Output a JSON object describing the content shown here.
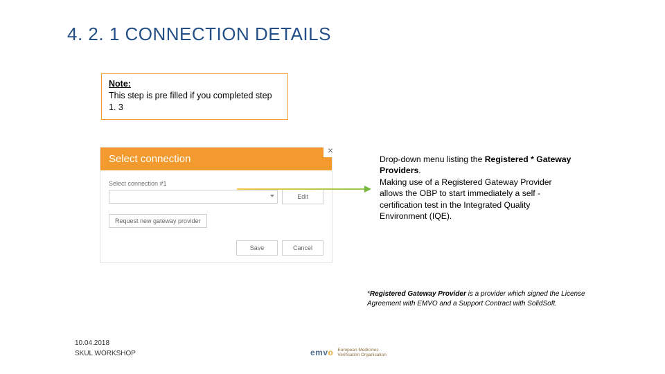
{
  "heading": "4. 2. 1 CONNECTION DETAILS",
  "note": {
    "label": "Note:",
    "body": "This step is pre filled if you completed step 1. 3"
  },
  "panel": {
    "title": "Select connection",
    "close_glyph": "×",
    "field_label": "Select connection #1",
    "select_placeholder": "",
    "edit_label": "Edit",
    "request_label": "Request new gateway provider",
    "save_label": "Save",
    "cancel_label": "Cancel"
  },
  "desc": {
    "line1": "Drop-down menu listing the ",
    "bold1": "Registered * Gateway Providers",
    "period": ".",
    "line2": "Making use of a Registered Gateway Provider allows the OBP to start immediately a self -certification test in the Integrated Quality Environment (IQE)."
  },
  "footnote": {
    "star": "*",
    "bold": "Registered Gateway Provider",
    "rest": " is a provider which signed the License Agreement with EMVO and a Support Contract with SolidSoft."
  },
  "footer": {
    "date": "10.04.2018",
    "event": "SKUL WORKSHOP",
    "logo_primary": "emv",
    "logo_accent": "o",
    "logo_sub1": "European Medicines",
    "logo_sub2": "Verification Organisation"
  }
}
